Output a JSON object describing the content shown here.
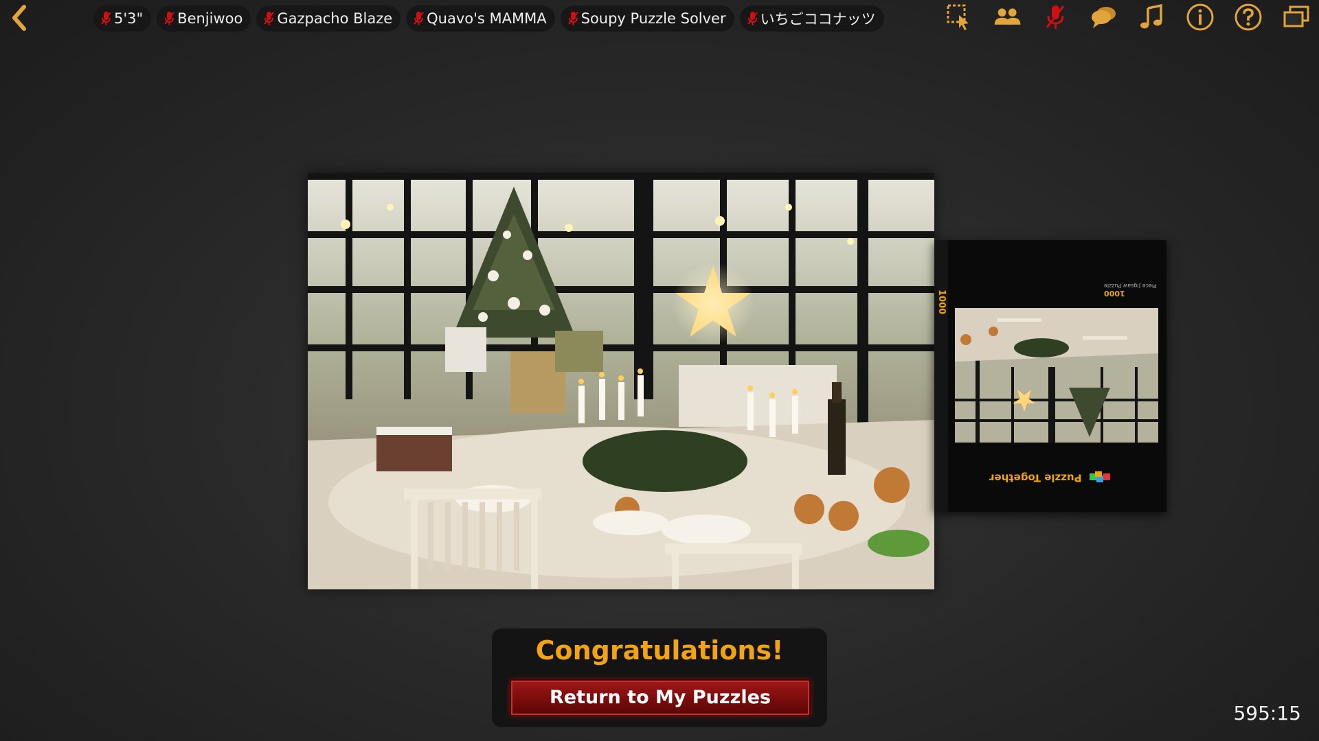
{
  "nav": {
    "back_icon": "chevron-left-icon"
  },
  "players": [
    {
      "name": "5'3\"",
      "mic": "muted"
    },
    {
      "name": "Benjiwoo",
      "mic": "muted"
    },
    {
      "name": "Gazpacho Blaze",
      "mic": "muted"
    },
    {
      "name": "Quavo's MAMMA",
      "mic": "muted"
    },
    {
      "name": "Soupy Puzzle Solver",
      "mic": "muted"
    },
    {
      "name": "いちごココナッツ",
      "mic": "muted"
    }
  ],
  "toolbar": {
    "icons": [
      "select-area-icon",
      "players-icon",
      "mic-muted-icon",
      "chat-icon",
      "music-icon",
      "info-icon",
      "help-icon",
      "windows-icon"
    ]
  },
  "box": {
    "piece_count_side": "1000",
    "piece_count": "1000",
    "piece_text": "Piece Jigsaw Puzzle",
    "brand": "Puzzle Together"
  },
  "completion": {
    "title": "Congratulations!",
    "return_label": "Return to My Puzzles"
  },
  "timer": "595:15",
  "colors": {
    "accent": "#f2a311",
    "button_red": "#8a1010",
    "mic_red": "#d01010"
  }
}
